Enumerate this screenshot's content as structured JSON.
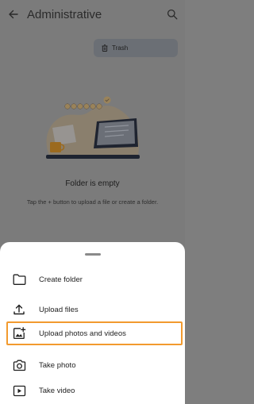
{
  "app_bar": {
    "title": "Administrative",
    "back_icon": "arrow-left-icon",
    "search_icon": "search-icon"
  },
  "trash_chip": {
    "label": "Trash",
    "icon": "trash-icon"
  },
  "empty_state": {
    "title": "Folder is empty",
    "subtitle": "Tap the + button to upload a file or create a folder."
  },
  "sheet": {
    "items": [
      {
        "label": "Create folder",
        "icon": "folder-icon"
      },
      {
        "label": "Upload files",
        "icon": "upload-icon"
      },
      {
        "label": "Upload photos and videos",
        "icon": "add-photo-icon",
        "highlighted": true
      },
      {
        "label": "Take photo",
        "icon": "camera-icon"
      },
      {
        "label": "Take video",
        "icon": "video-camera-icon"
      }
    ]
  },
  "colors": {
    "highlight": "#f29a2e",
    "scrim": "#7b7b7b",
    "sheet": "#ffffff"
  }
}
